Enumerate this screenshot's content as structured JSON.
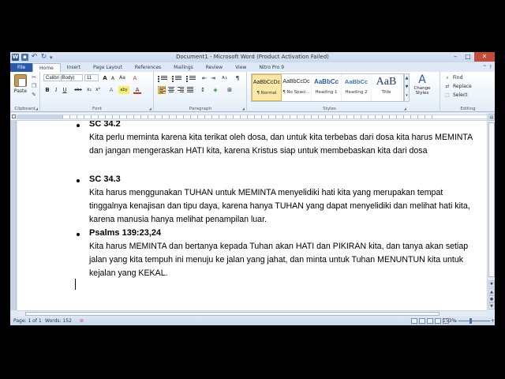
{
  "titlebar": {
    "title": "Document1 - Microsoft Word (Product Activation Failed)",
    "app_icon": "W",
    "window_controls": {
      "minimize": "–",
      "maximize": "□",
      "close": "✕"
    }
  },
  "tabs": [
    {
      "label": "File"
    },
    {
      "label": "Home"
    },
    {
      "label": "Insert"
    },
    {
      "label": "Page Layout"
    },
    {
      "label": "References"
    },
    {
      "label": "Mailings"
    },
    {
      "label": "Review"
    },
    {
      "label": "View"
    },
    {
      "label": "Nitro Pro 9"
    }
  ],
  "ribbon": {
    "clipboard": {
      "label": "Clipboard",
      "paste": "Paste"
    },
    "font": {
      "label": "Font",
      "font_name": "Calibri (Body)",
      "font_size": "11",
      "grow": "A",
      "shrink": "A",
      "change_case": "Aa",
      "clear_formatting": "A",
      "bold": "B",
      "italic": "I",
      "underline": "U",
      "strike": "abe",
      "subscript": "x₂",
      "superscript": "x²",
      "text_effects": "A",
      "highlight": "aby",
      "font_color": "A"
    },
    "paragraph": {
      "label": "Paragraph",
      "pilcrow": "¶",
      "sort": "A↓"
    },
    "styles": {
      "label": "Styles",
      "items": [
        {
          "sample": "AaBbCcDc",
          "name": "¶ Normal"
        },
        {
          "sample": "AaBbCcDc",
          "name": "¶ No Spaci..."
        },
        {
          "sample": "AaBbCc",
          "name": "Heading 1"
        },
        {
          "sample": "AaBbCc",
          "name": "Heading 2"
        },
        {
          "sample": "AaB",
          "name": "Title"
        }
      ],
      "change_styles": "Change Styles"
    },
    "editing": {
      "label": "Editing",
      "find": "Find",
      "replace": "Replace",
      "select": "Select"
    }
  },
  "document": {
    "entries": [
      {
        "heading": "SC 34.2",
        "text": "Kita perlu meminta karena kita terikat oleh dosa, dan untuk kita terbebas dari dosa kita harus MEMINTA dan jangan mengeraskan HATI kita, karena Kristus siap untuk membebaskan kita dari dosa"
      },
      {
        "heading": "SC 34.3",
        "text": "Kita harus menggunakan TUHAN untuk  MEMINTA menyelidiki hati kita yang merupakan tempat tinggalnya kenajisan dan tipu daya, karena hanya TUHAN yang dapat menyelidiki dan melihat hati kita, karena manusia hanya melihat penampilan luar."
      },
      {
        "heading": "Psalms 139:23,24",
        "text": "Kita harus MEMINTA dan bertanya kepada Tuhan akan HATI dan PIKIRAN kita, dan tanya akan setiap jalan yang kita tempuh ini menuju ke jalan yang jahat, dan minta untuk Tuhan MENUNTUN kita untuk kejalan yang KEKAL."
      }
    ]
  },
  "statusbar": {
    "page": "Page: 1 of 1",
    "words": "Words: 152",
    "zoom": "153%",
    "zoom_minus": "−",
    "zoom_plus": "+"
  }
}
